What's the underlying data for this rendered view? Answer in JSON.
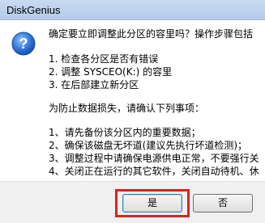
{
  "dialog": {
    "title": "DiskGenius",
    "icon": "question-icon",
    "message_lines": [
      "确定要立即调整此分区的容里吗？操作步骤包括",
      "",
      "1. 检查各分区是否有错误",
      "2. 调整 SYSCEO(K:) 的容里",
      "3. 在后部建立新分区",
      "",
      "为防止数据损失，请确认下列事项：",
      "",
      "1、请先备份该分区内的重要数据；",
      "2、确保该磁盘无坏道(建议先执行坏道检测)；",
      "3、调整过程中请确保电源供电正常，不要强行关",
      "4、关闭正在运行的其它软件，关闭自动待机、休"
    ],
    "buttons": {
      "yes_label": "是",
      "no_label": "否"
    },
    "highlight_color": "#e02020"
  }
}
